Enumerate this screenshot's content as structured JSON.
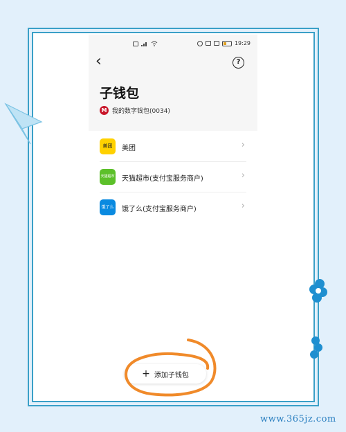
{
  "status_bar": {
    "time": "19:29",
    "left_icons": [
      "sim-icon",
      "signal-icon",
      "wifi-icon"
    ],
    "right_icons": [
      "nfc-icon",
      "mute-icon",
      "vibrate-icon",
      "battery-icon"
    ]
  },
  "header": {
    "back_icon": "‹",
    "help_icon": "?",
    "title": "子钱包",
    "subtitle": "我的数字钱包(0034)",
    "bank_logo": "cmb-logo"
  },
  "wallets": [
    {
      "label": "美团",
      "icon_text": "美团",
      "icon_color": "#ffd100"
    },
    {
      "label": "天猫超市(支付宝服务商户)",
      "icon_text": "天猫超市",
      "icon_color": "#5cc02a"
    },
    {
      "label": "饿了么(支付宝服务商户)",
      "icon_text": "饿了么",
      "icon_color": "#0a8ae0"
    }
  ],
  "add_button": {
    "icon": "+",
    "label": "添加子钱包"
  },
  "watermark": "www.365jz.com",
  "colors": {
    "frame": "#3aa0c8",
    "background": "#e2f0fb",
    "annotation": "#f08a2a"
  }
}
